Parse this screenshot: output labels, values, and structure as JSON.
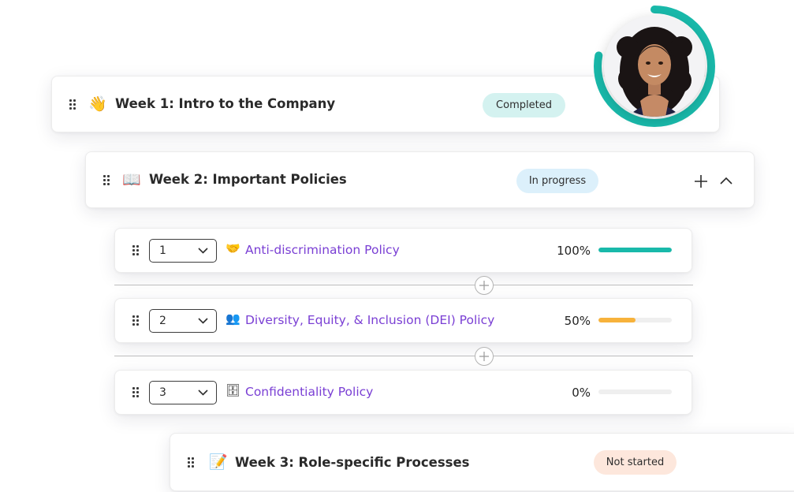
{
  "weeks": [
    {
      "emoji": "👋",
      "title": "Week 1: Intro to the Company",
      "status": "Completed"
    },
    {
      "emoji": "📖",
      "title": "Week 2: Important Policies",
      "status": "In progress"
    },
    {
      "emoji": "📝",
      "title": "Week 3: Role-specific Processes",
      "status": "Not started"
    }
  ],
  "lessons": [
    {
      "order": "1",
      "emoji": "🤝",
      "title": "Anti-discrimination Policy",
      "percent_label": "100%",
      "progress": 1.0,
      "color": "#19b9aa"
    },
    {
      "order": "2",
      "emoji": "👥",
      "title": "Diversity, Equity, & Inclusion (DEI) Policy",
      "percent_label": "50%",
      "progress": 0.5,
      "color": "#f7b23b"
    },
    {
      "order": "3",
      "emoji": "🗄",
      "title": "Confidentiality Policy",
      "percent_label": "0%",
      "progress": 0,
      "color": "#19b9aa"
    }
  ],
  "colors": {
    "accent": "#19b9aa",
    "link": "#7a3fd4",
    "warning": "#f7b23b"
  },
  "avatar": {
    "ring_progress": 0.78
  }
}
